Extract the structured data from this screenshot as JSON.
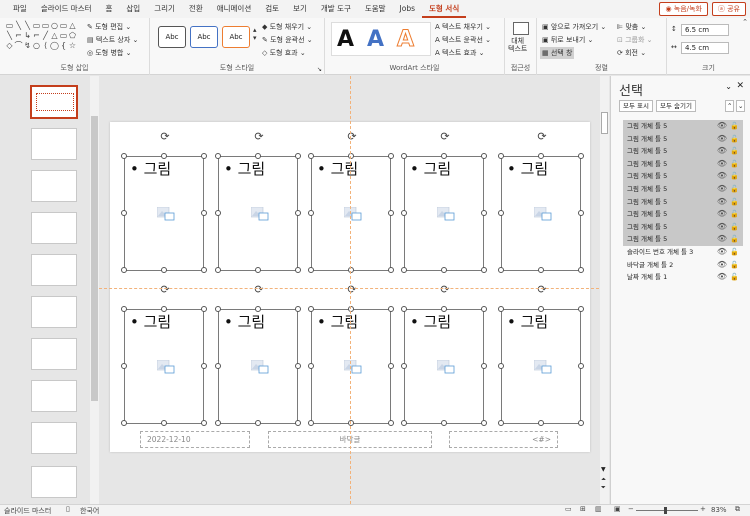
{
  "menu": {
    "tabs": [
      "파일",
      "슬라이드 마스터",
      "홈",
      "삽입",
      "그리기",
      "전환",
      "애니메이션",
      "검토",
      "보기",
      "개발 도구",
      "도움말",
      "Jobs",
      "도형 서식"
    ],
    "active_tab": "도형 서식",
    "record_label": "◉ 녹음/녹화",
    "share_label": "ⓐ 공유"
  },
  "ribbon": {
    "insert_shapes": {
      "edit_shape": "도형 편집",
      "text_box": "텍스트 상자",
      "merge_shapes": "도형 병합",
      "label": "도형 삽입"
    },
    "shape_styles": {
      "sample": "Abc",
      "fill": "도형 채우기",
      "outline": "도형 윤곽선",
      "effects": "도형 효과",
      "label": "도형 스타일"
    },
    "wordart": {
      "letter": "A",
      "text_fill": "텍스트 채우기",
      "text_outline": "텍스트 윤곽선",
      "text_effects": "텍스트 효과",
      "label": "WordArt 스타일"
    },
    "accessibility": {
      "alt_text": "대체\n텍스트",
      "label": "접근성"
    },
    "arrange": {
      "bring_forward": "앞으로 가져오기",
      "send_backward": "뒤로 보내기",
      "selection_pane": "선택 창",
      "align": "맞춤",
      "group": "그룹화",
      "rotate": "회전",
      "label": "정렬"
    },
    "size": {
      "height": "6.5 cm",
      "width": "4.5 cm",
      "label": "크기"
    }
  },
  "slide": {
    "placeholder_text": "• 그림",
    "footer_date": "2022-12-10",
    "footer_text": "바닥글",
    "footer_num": "<#>"
  },
  "selection_pane": {
    "title": "선택",
    "show_all": "모두 표시",
    "hide_all": "모두 숨기기",
    "items": [
      {
        "label": "그림 개체 틀 5",
        "selected": true
      },
      {
        "label": "그림 개체 틀 5",
        "selected": true
      },
      {
        "label": "그림 개체 틀 5",
        "selected": true
      },
      {
        "label": "그림 개체 틀 5",
        "selected": true
      },
      {
        "label": "그림 개체 틀 5",
        "selected": true
      },
      {
        "label": "그림 개체 틀 5",
        "selected": true
      },
      {
        "label": "그림 개체 틀 5",
        "selected": true
      },
      {
        "label": "그림 개체 틀 5",
        "selected": true
      },
      {
        "label": "그림 개체 틀 5",
        "selected": true
      },
      {
        "label": "그림 개체 틀 5",
        "selected": true
      },
      {
        "label": "슬라이드 번호 개체 틀 3",
        "selected": false
      },
      {
        "label": "바닥글 개체 틀 2",
        "selected": false
      },
      {
        "label": "날짜 개체 틀 1",
        "selected": false
      }
    ]
  },
  "status": {
    "view": "슬라이드 마스터",
    "language": "한국어",
    "zoom": "83%"
  },
  "colors": {
    "accent": "#c43e1c",
    "guide": "#f2b27a",
    "selected_item": "#c8c8c8"
  }
}
